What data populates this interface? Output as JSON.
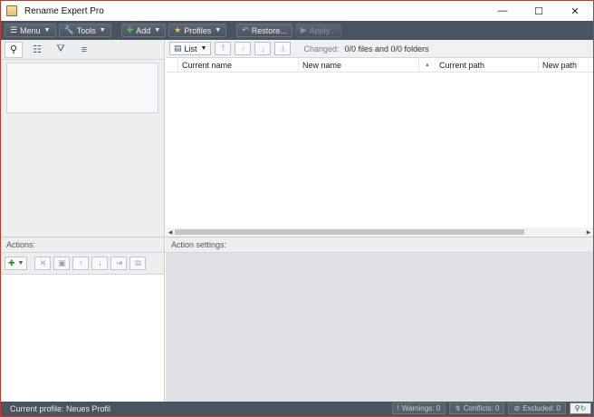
{
  "window": {
    "title": "Rename Expert Pro",
    "controls": {
      "minimize": "—",
      "maximize": "☐",
      "close": "✕"
    }
  },
  "toolbar": {
    "menu": {
      "label": "Menu",
      "icon": "menu-icon"
    },
    "tools": {
      "label": "Tools",
      "icon": "wrench-icon"
    },
    "add": {
      "label": "Add",
      "icon": "plus-icon"
    },
    "profiles": {
      "label": "Profiles",
      "icon": "star-icon"
    },
    "restore": {
      "label": "Restore...",
      "icon": "undo-icon"
    },
    "apply": {
      "label": "Apply...",
      "icon": "play-icon",
      "enabled": false
    }
  },
  "left_tabs": [
    "search-icon",
    "tree-icon",
    "filter-icon",
    "list-icon"
  ],
  "list_toolbar": {
    "view_label": "List",
    "changed_label": "Changed:",
    "changed_value": "0/0 files and 0/0 folders"
  },
  "columns": [
    "Current name",
    "New name",
    "Current path",
    "New path"
  ],
  "actions": {
    "title": "Actions:"
  },
  "action_settings": {
    "title": "Action settings:"
  },
  "statusbar": {
    "profile": "Current profile: Neues Profil",
    "warnings": "Warnings: 0",
    "conflicts": "Conflicts: 0",
    "excluded": "Excluded: 0"
  },
  "colors": {
    "toolbar_bg": "#4a5360",
    "window_border": "#c0392b",
    "add_green": "#2c8a2c"
  }
}
